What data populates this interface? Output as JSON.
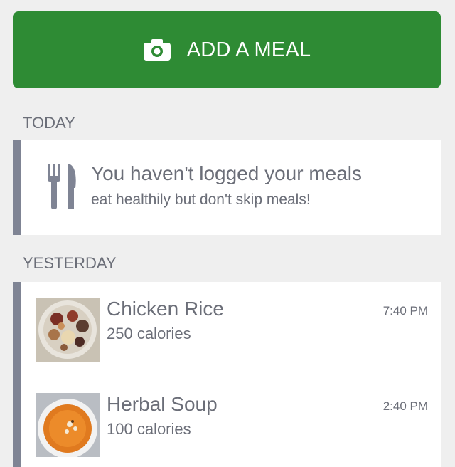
{
  "header": {
    "add_meal_label": "ADD A MEAL",
    "add_meal_icon": "camera-icon",
    "accent_color": "#2e8b34"
  },
  "today": {
    "section_label": "TODAY",
    "empty_state": {
      "icon": "utensils-icon",
      "title": "You haven't logged your meals",
      "subtitle": "eat healthily but don't skip meals!"
    }
  },
  "yesterday": {
    "section_label": "YESTERDAY",
    "meals": [
      {
        "name": "Chicken Rice",
        "calories": "250 calories",
        "time": "7:40 PM",
        "thumbnail": "food-platter-photo"
      },
      {
        "name": "Herbal Soup",
        "calories": "100 calories",
        "time": "2:40 PM",
        "thumbnail": "soup-bowl-photo"
      }
    ]
  },
  "colors": {
    "background": "#efefef",
    "card_accent_border": "#7f8494",
    "text_muted": "#6b6e78"
  }
}
